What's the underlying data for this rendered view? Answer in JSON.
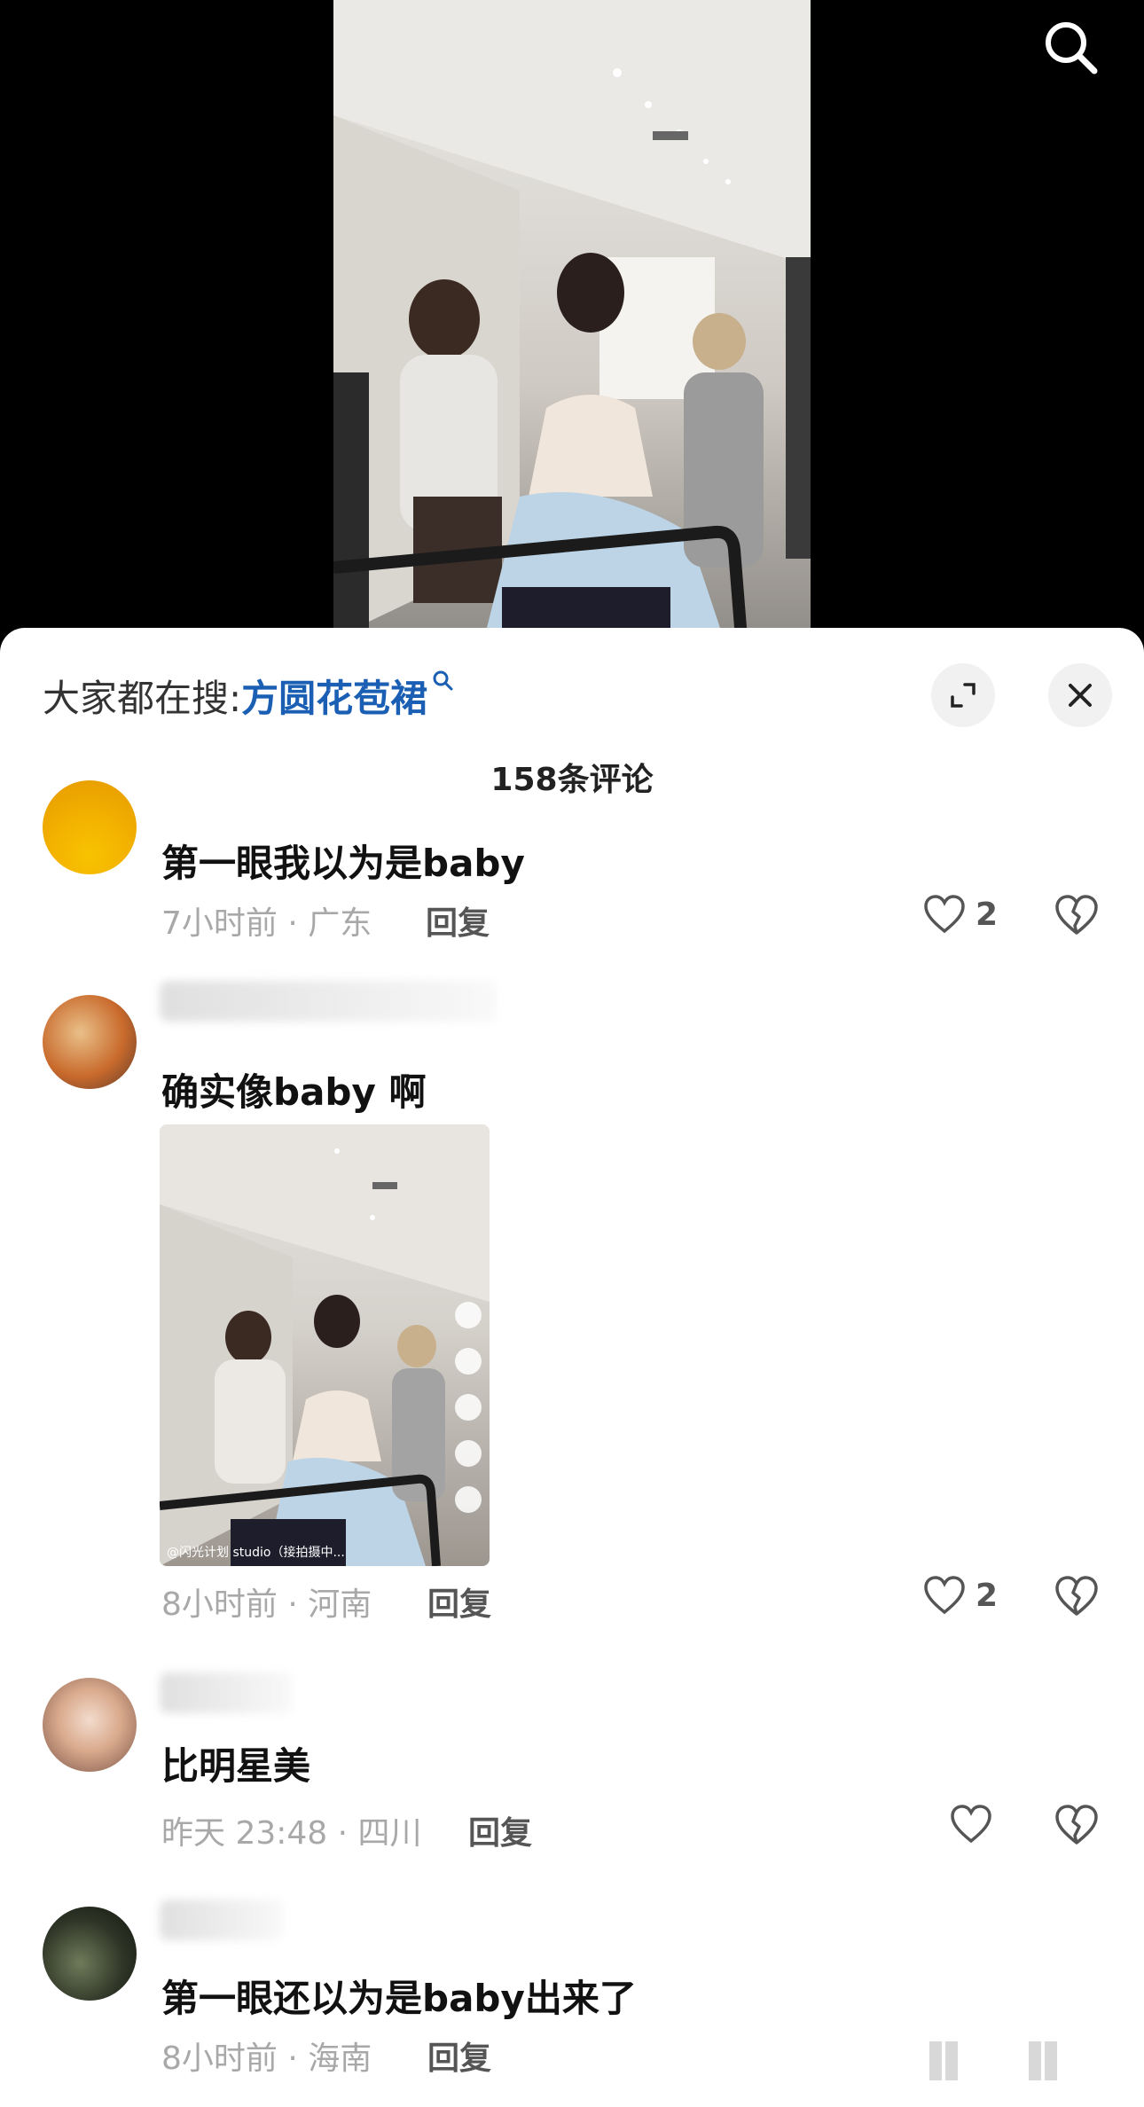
{
  "search_suggest": {
    "prefix": "大家都在搜:",
    "keyword": "方圆花苞裙"
  },
  "comment_count": "158条评论",
  "comments": [
    {
      "text": "第一眼我以为是baby",
      "meta": "7小时前 · 广东",
      "reply": "回复",
      "likes": "2"
    },
    {
      "text": "确实像baby 啊",
      "meta": "8小时前 · 河南",
      "reply": "回复",
      "likes": "2",
      "image_caption": "@闪光计划 studio（接拍摄中..."
    },
    {
      "text": "比明星美",
      "meta": "昨天 23:48 · 四川",
      "reply": "回复",
      "likes": ""
    },
    {
      "text": "第一眼还以为是baby出来了",
      "meta": "8小时前 · 海南",
      "reply": "回复"
    }
  ],
  "icons": {
    "top_search": "search-icon",
    "expand": "expand-icon",
    "close": "close-icon",
    "like": "heart-icon",
    "dislike": "broken-heart-icon"
  },
  "colors": {
    "keyword": "#1a5fb4",
    "meta": "#a8a8a8",
    "sheet": "#ffffff"
  }
}
